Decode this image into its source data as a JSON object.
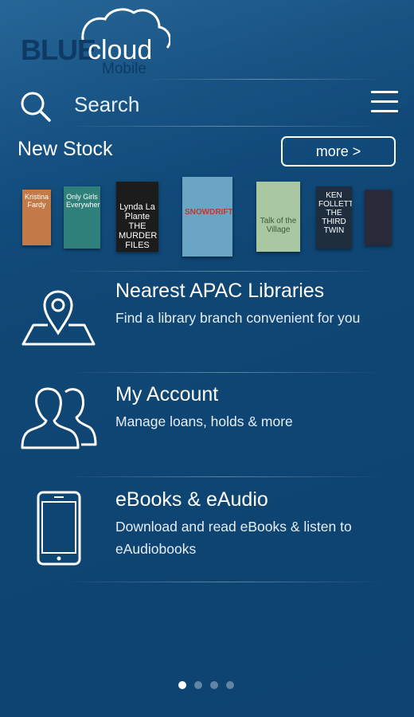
{
  "brand": {
    "blue": "BLUE",
    "cloud": "cloud",
    "mobile": "Mobile"
  },
  "search": {
    "label": "Search"
  },
  "new_stock": {
    "title": "New Stock",
    "more_label": "more >",
    "books": [
      {
        "title": "Kristina Fardy",
        "color": "#c27a48"
      },
      {
        "title": "Only Girls Everywhere",
        "color": "#2f7f7a"
      },
      {
        "title": "Lynda La Plante THE MURDER FILES",
        "color": "#1c1c1c"
      },
      {
        "title": "SNOWDRIFT",
        "color": "#6aa6c4"
      },
      {
        "title": "Talk of the Village",
        "color": "#a9c7a0"
      },
      {
        "title": "KEN FOLLETT THE THIRD TWIN",
        "color": "#1e2e3e"
      },
      {
        "title": "",
        "color": "#2a2a3a"
      }
    ]
  },
  "menu_items": [
    {
      "title": "Nearest APAC Libraries",
      "desc": "Find a library branch convenient for you"
    },
    {
      "title": "My Account",
      "desc": "Manage loans, holds & more"
    },
    {
      "title": "eBooks & eAudio",
      "desc": "Download and read eBooks & listen to eAudiobooks"
    }
  ],
  "colors": {
    "background": "#0f4674",
    "logo_dark": "#0d3b66"
  },
  "pager": {
    "count": 4,
    "active": 0
  }
}
